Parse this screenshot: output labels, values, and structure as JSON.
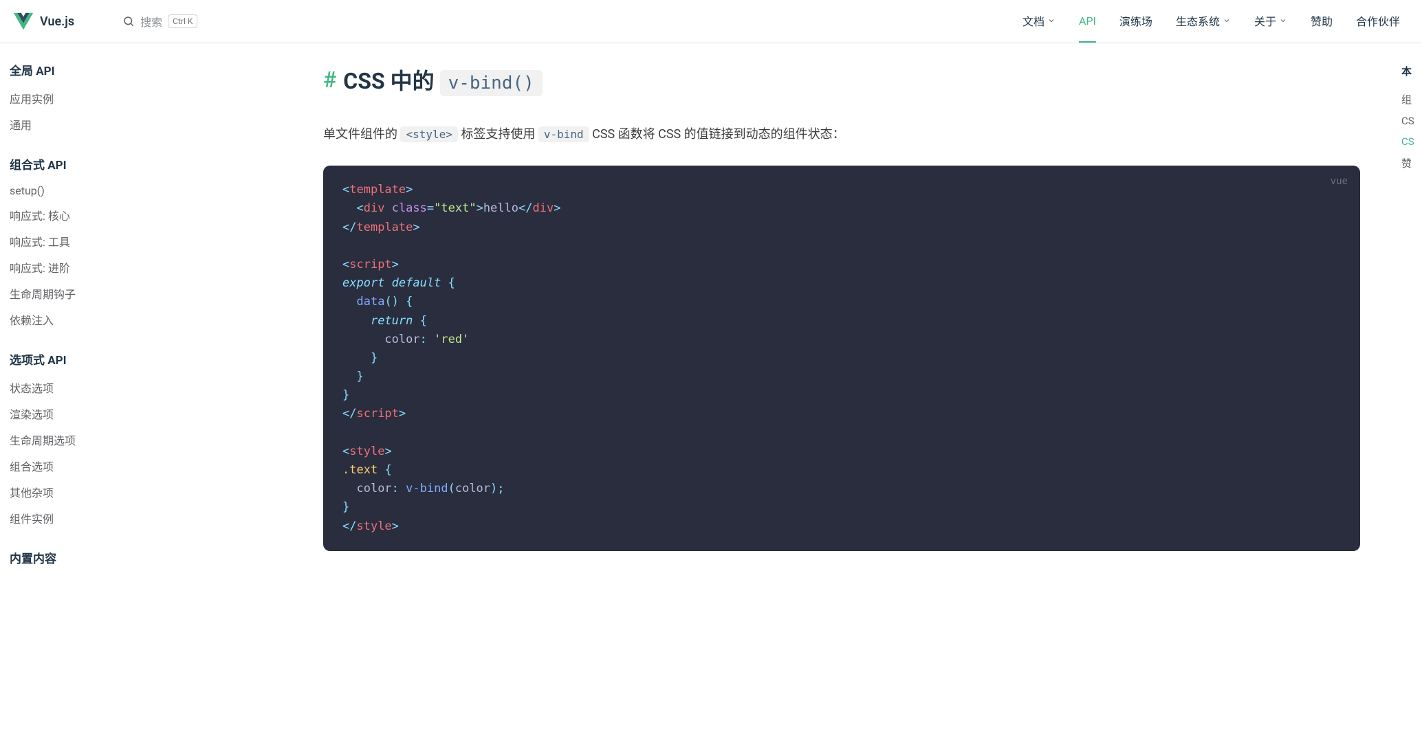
{
  "brand": "Vue.js",
  "search": {
    "placeholder": "搜索",
    "shortcut": "Ctrl K"
  },
  "nav": [
    {
      "label": "文档",
      "dropdown": true,
      "active": false
    },
    {
      "label": "API",
      "dropdown": false,
      "active": true
    },
    {
      "label": "演练场",
      "dropdown": false,
      "active": false
    },
    {
      "label": "生态系统",
      "dropdown": true,
      "active": false
    },
    {
      "label": "关于",
      "dropdown": true,
      "active": false
    },
    {
      "label": "赞助",
      "dropdown": false,
      "active": false
    },
    {
      "label": "合作伙伴",
      "dropdown": false,
      "active": false
    }
  ],
  "sidebar": [
    {
      "title": "全局 API",
      "items": [
        "应用实例",
        "通用"
      ]
    },
    {
      "title": "组合式 API",
      "items": [
        "setup()",
        "响应式: 核心",
        "响应式: 工具",
        "响应式: 进阶",
        "生命周期钩子",
        "依赖注入"
      ]
    },
    {
      "title": "选项式 API",
      "items": [
        "状态选项",
        "渲染选项",
        "生命周期选项",
        "组合选项",
        "其他杂项",
        "组件实例"
      ]
    },
    {
      "title": "内置内容",
      "items": []
    }
  ],
  "main": {
    "anchor": "#",
    "title_prefix": "CSS 中的 ",
    "title_code": "v-bind()",
    "para_parts": {
      "p1": "单文件组件的 ",
      "c1": "<style>",
      "p2": " 标签支持使用 ",
      "c2": "v-bind",
      "p3": " CSS 函数将 CSS 的值链接到动态的组件状态："
    },
    "code_lang": "vue"
  },
  "aside": {
    "title": "本",
    "items": [
      {
        "label": "组",
        "active": false
      },
      {
        "label": "CS",
        "active": false
      },
      {
        "label": "CS",
        "active": true
      },
      {
        "label": "赞",
        "active": false
      }
    ]
  }
}
